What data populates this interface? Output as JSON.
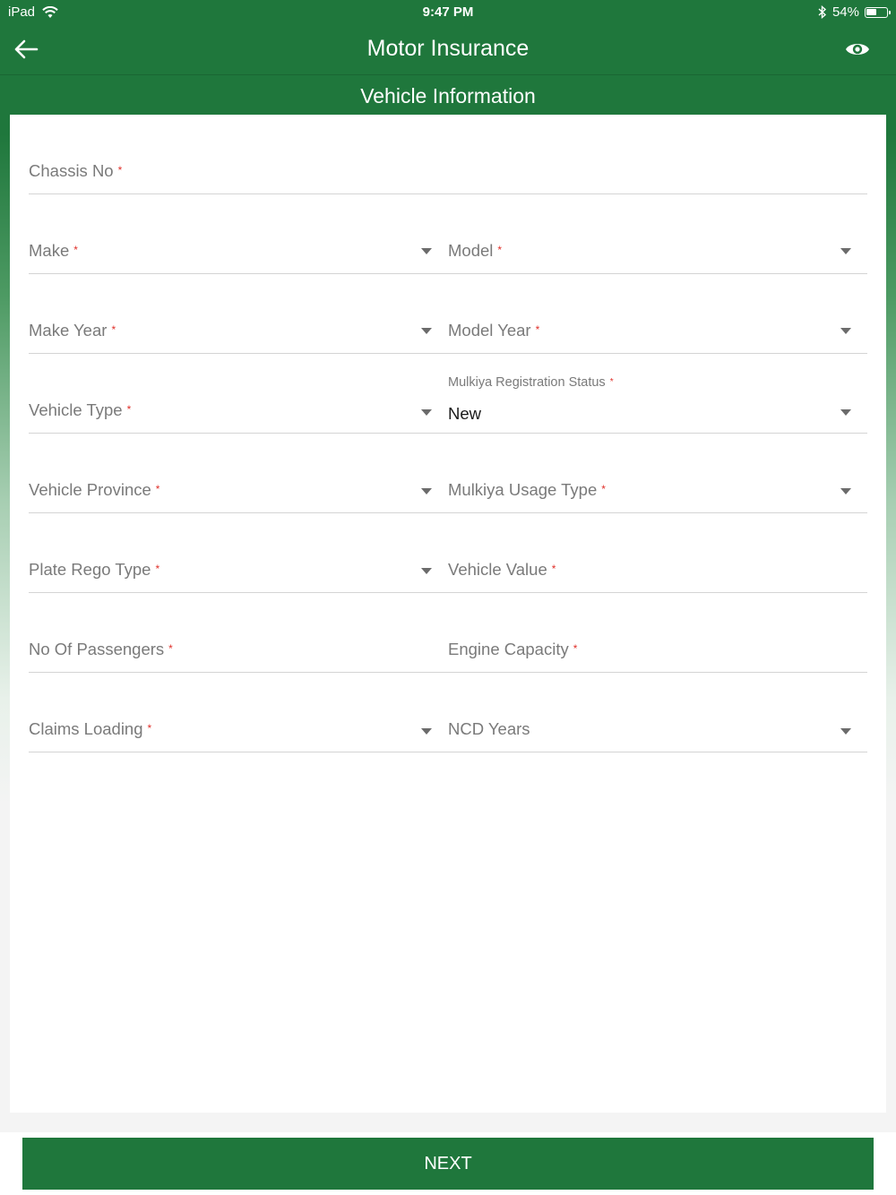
{
  "status_bar": {
    "device": "iPad",
    "time": "9:47 PM",
    "battery": "54%",
    "battery_level": 0.54,
    "icons": [
      "wifi-icon",
      "bluetooth-icon",
      "battery-icon"
    ]
  },
  "header": {
    "title": "Motor Insurance",
    "back_icon": "arrow-left-icon",
    "view_icon": "eye-icon"
  },
  "section": {
    "title": "Vehicle Information"
  },
  "colors": {
    "brand_green": "#1f773c",
    "required": "#e0302a"
  },
  "form": {
    "required_mark": "*",
    "chassis_no": {
      "label": "Chassis No"
    },
    "make": {
      "label": "Make"
    },
    "model": {
      "label": "Model"
    },
    "make_year": {
      "label": "Make Year"
    },
    "model_year": {
      "label": "Model Year"
    },
    "vehicle_type": {
      "label": "Vehicle Type"
    },
    "mulkiya_registration_status": {
      "label": "Mulkiya Registration Status",
      "value": "New"
    },
    "vehicle_province": {
      "label": "Vehicle Province"
    },
    "mulkiya_usage_type": {
      "label": "Mulkiya Usage Type"
    },
    "plate_rego_type": {
      "label": "Plate Rego Type"
    },
    "vehicle_value": {
      "label": "Vehicle Value"
    },
    "no_of_passengers": {
      "label": "No Of Passengers"
    },
    "engine_capacity": {
      "label": "Engine Capacity"
    },
    "claims_loading": {
      "label": "Claims Loading"
    },
    "ncd_years": {
      "label": "NCD Years"
    }
  },
  "footer": {
    "next_label": "NEXT"
  }
}
